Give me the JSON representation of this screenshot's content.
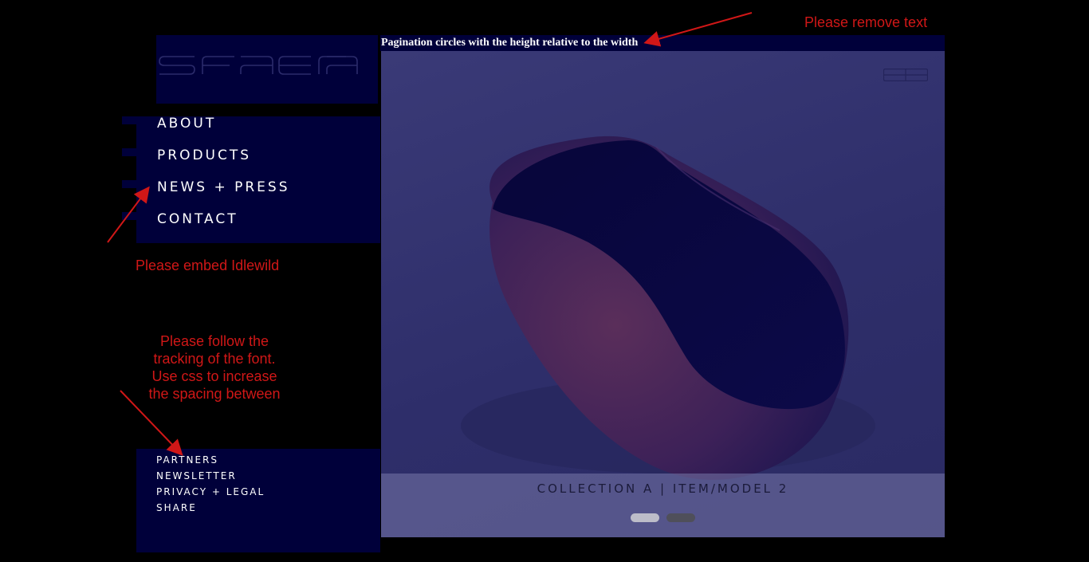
{
  "logo": {
    "text": "SFAERA",
    "color": "#2b2b6b"
  },
  "header": {
    "text": "Pagination circles with the height relative to the width"
  },
  "nav": {
    "items": [
      {
        "label": "ABOUT"
      },
      {
        "label": "PRODUCTS"
      },
      {
        "label": "NEWS + PRESS"
      },
      {
        "label": "CONTACT"
      }
    ]
  },
  "footer_nav": {
    "items": [
      {
        "label": "PARTNERS"
      },
      {
        "label": "NEWSLETTER"
      },
      {
        "label": "PRIVACY + LEGAL"
      },
      {
        "label": "SHARE"
      }
    ]
  },
  "hero": {
    "caption": "COLLECTION A | ITEM/MODEL 2",
    "grid_icon": "grid-icon",
    "pagination": {
      "active_index": 0,
      "count": 2
    }
  },
  "annotations": {
    "remove_text": "Please remove text",
    "embed_font": "Please embed Idlewild",
    "tracking": [
      "Please follow the",
      "tracking of the font.",
      "Use css to increase",
      "the spacing between"
    ]
  },
  "colors": {
    "panel": "#00003a",
    "annotation": "#d01717",
    "dot_active": "#bdbdc9",
    "dot_inactive": "#4f4f5a"
  }
}
